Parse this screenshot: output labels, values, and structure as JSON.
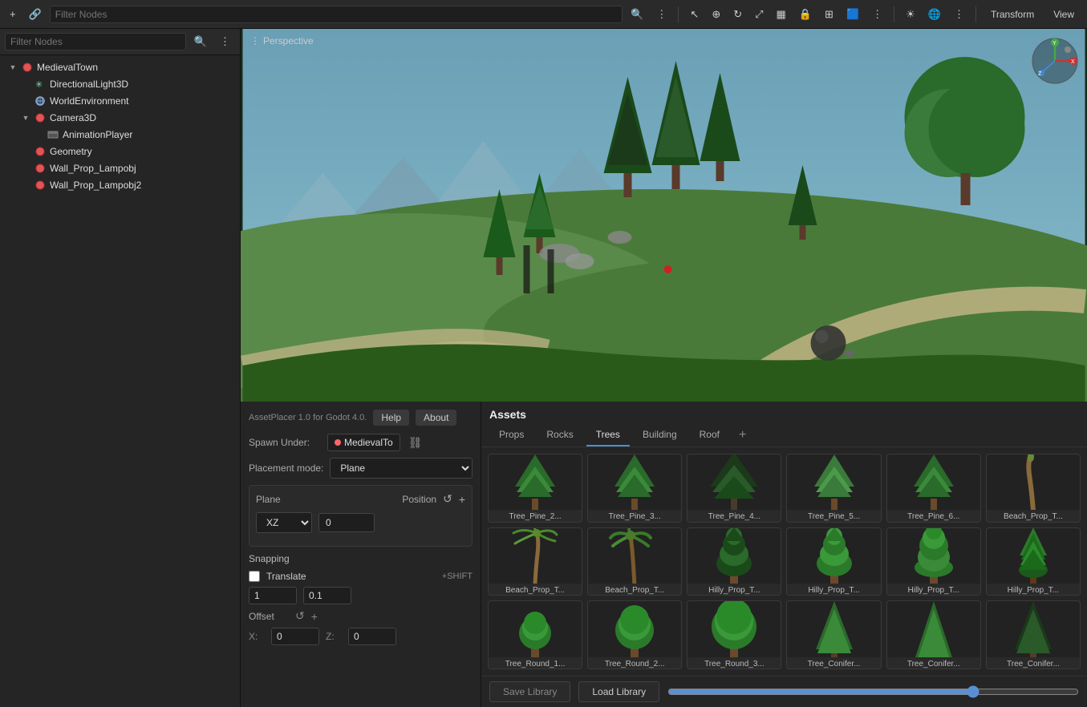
{
  "toolbar": {
    "filter_placeholder": "Filter Nodes",
    "transform_label": "Transform",
    "view_label": "View"
  },
  "scene_tree": {
    "items": [
      {
        "id": "medieval-town",
        "label": "MedievalTown",
        "icon": "🔴",
        "arrow": "▼",
        "indent": 0,
        "has_eye": true
      },
      {
        "id": "directional-light",
        "label": "DirectionalLight3D",
        "icon": "✳",
        "arrow": "",
        "indent": 1,
        "has_eye": true
      },
      {
        "id": "world-environment",
        "label": "WorldEnvironment",
        "icon": "🌐",
        "arrow": "",
        "indent": 1,
        "has_eye": false
      },
      {
        "id": "camera3d",
        "label": "Camera3D",
        "icon": "🔴",
        "arrow": "▼",
        "indent": 1,
        "has_eye": true
      },
      {
        "id": "animation-player",
        "label": "AnimationPlayer",
        "icon": "🎬",
        "arrow": "",
        "indent": 2,
        "has_eye": false
      },
      {
        "id": "geometry",
        "label": "Geometry",
        "icon": "🔴",
        "arrow": "",
        "indent": 1,
        "has_eye": true
      },
      {
        "id": "wall-prop-lamp",
        "label": "Wall_Prop_Lampobj",
        "icon": "🔴",
        "arrow": "",
        "indent": 1,
        "has_eye": true
      },
      {
        "id": "wall-prop-lamp2",
        "label": "Wall_Prop_Lampobj2",
        "icon": "🔴",
        "arrow": "",
        "indent": 1,
        "has_eye": true
      }
    ]
  },
  "viewport": {
    "label": "Perspective"
  },
  "placer": {
    "version": "AssetPlacer 1.0 for Godot 4.0.",
    "help_label": "Help",
    "about_label": "About",
    "spawn_under_label": "Spawn Under:",
    "spawn_target": "MedievalTo",
    "placement_mode_label": "Placement mode:",
    "placement_mode_value": "Plane",
    "plane_label": "Plane",
    "position_label": "Position",
    "plane_axis": "XZ",
    "position_value": "0",
    "snapping_title": "Snapping",
    "translate_label": "Translate",
    "translate_shortcut": "+SHIFT",
    "translate_value": "1",
    "translate_fine": "0.1",
    "offset_label": "Offset",
    "offset_x_label": "X:",
    "offset_x_value": "0",
    "offset_z_label": "Z:",
    "offset_z_value": "0"
  },
  "assets": {
    "title": "Assets",
    "tabs": [
      {
        "id": "props",
        "label": "Props"
      },
      {
        "id": "rocks",
        "label": "Rocks"
      },
      {
        "id": "trees",
        "label": "Trees",
        "active": true
      },
      {
        "id": "building",
        "label": "Building"
      },
      {
        "id": "roof",
        "label": "Roof"
      }
    ],
    "items": [
      {
        "id": "tree-pine-2",
        "name": "Tree_Pine_2...",
        "type": "pine"
      },
      {
        "id": "tree-pine-3",
        "name": "Tree_Pine_3...",
        "type": "pine"
      },
      {
        "id": "tree-pine-4",
        "name": "Tree_Pine_4...",
        "type": "pine-dark"
      },
      {
        "id": "tree-pine-5",
        "name": "Tree_Pine_5...",
        "type": "pine-small"
      },
      {
        "id": "tree-pine-6",
        "name": "Tree_Pine_6...",
        "type": "pine"
      },
      {
        "id": "beach-prop-t1",
        "name": "Beach_Prop_T...",
        "type": "palm-bare"
      },
      {
        "id": "beach-prop-t2",
        "name": "Beach_Prop_T...",
        "type": "palm"
      },
      {
        "id": "beach-prop-t3",
        "name": "Beach_Prop_T...",
        "type": "palm-full"
      },
      {
        "id": "hilly-prop-t1",
        "name": "Hilly_Prop_T...",
        "type": "hilly-dark"
      },
      {
        "id": "hilly-prop-t2",
        "name": "Hilly_Prop_T...",
        "type": "hilly"
      },
      {
        "id": "hilly-prop-t3",
        "name": "Hilly_Prop_T...",
        "type": "hilly-round"
      },
      {
        "id": "hilly-prop-t4",
        "name": "Hilly_Prop_T...",
        "type": "hilly-tall"
      },
      {
        "id": "tree-round-1",
        "name": "Tree_Round_1...",
        "type": "round-small"
      },
      {
        "id": "tree-round-2",
        "name": "Tree_Round_2...",
        "type": "round-med"
      },
      {
        "id": "tree-round-3",
        "name": "Tree_Round_3...",
        "type": "round-large"
      },
      {
        "id": "tree-conifer-1",
        "name": "Tree_Conifer...",
        "type": "conifer"
      },
      {
        "id": "tree-conifer-2",
        "name": "Tree_Conifer...",
        "type": "conifer-tall"
      },
      {
        "id": "tree-conifer-3",
        "name": "Tree_Conifer...",
        "type": "conifer-dark"
      }
    ],
    "save_library_label": "Save Library",
    "load_library_label": "Load Library",
    "zoom_value": 75
  },
  "icons": {
    "eye": "👁",
    "film": "🎬",
    "chain": "🔗",
    "reset": "↺",
    "plus": "+"
  }
}
